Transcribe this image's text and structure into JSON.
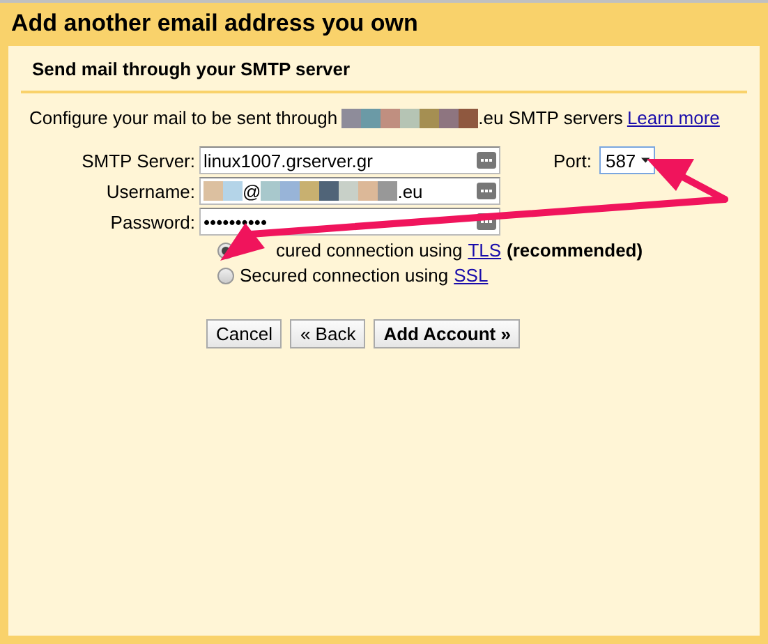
{
  "window": {
    "title": "Add another email address you own"
  },
  "section": {
    "heading": "Send mail through your SMTP server"
  },
  "intro": {
    "before": "Configure your mail to be sent through",
    "after": ".eu SMTP servers",
    "link": "Learn more"
  },
  "fields": [
    {
      "kind": "text",
      "label": "SMTP Server:",
      "value": "linux1007.grserver.gr"
    },
    {
      "kind": "masked",
      "label": "Username:",
      "at": "@",
      "suffix": ".eu"
    },
    {
      "kind": "password",
      "label": "Password:",
      "value": "••••••••••"
    }
  ],
  "port": {
    "label": "Port:",
    "value": "587"
  },
  "security": [
    {
      "label": "cured connection using",
      "link": "TLS",
      "note": "(recommended)",
      "selected": true
    },
    {
      "label": "Secured connection using",
      "link": "SSL",
      "selected": false
    }
  ],
  "buttons": [
    {
      "label": "Cancel",
      "primary": false
    },
    {
      "label": "« Back",
      "primary": false
    },
    {
      "label": "Add Account »",
      "primary": true
    }
  ]
}
